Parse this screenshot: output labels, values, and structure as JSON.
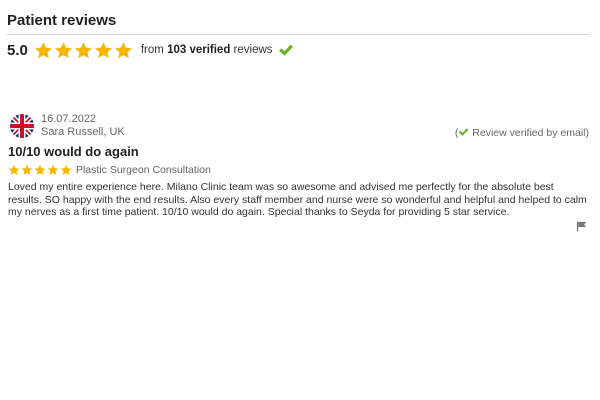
{
  "section": {
    "title": "Patient reviews"
  },
  "summary": {
    "score": "5.0",
    "stars": 5,
    "text_prefix": "from ",
    "count_text": "103 verified",
    "text_suffix": " reviews",
    "star_color": "#f5b800",
    "check_color": "#6ab42d"
  },
  "review": {
    "date": "16.07.2022",
    "author": "Sara Russell, UK",
    "flag_icon": "uk-flag-icon",
    "verified_open": "(",
    "verified_text": " Review verified by email)",
    "title": "10/10 would do again",
    "stars": 5,
    "category": "Plastic Surgeon Consultation",
    "body": "Loved my entire experience here. Milano Clinic team was so awesome and advised me perfectly for the absolute best results. SO happy with the end results. Also every staff member and nurse were so wonderful and helpful and helped to calm my nerves as a first time patient. 10/10 would do again. Special thanks to Seyda for providing 5 star service."
  }
}
